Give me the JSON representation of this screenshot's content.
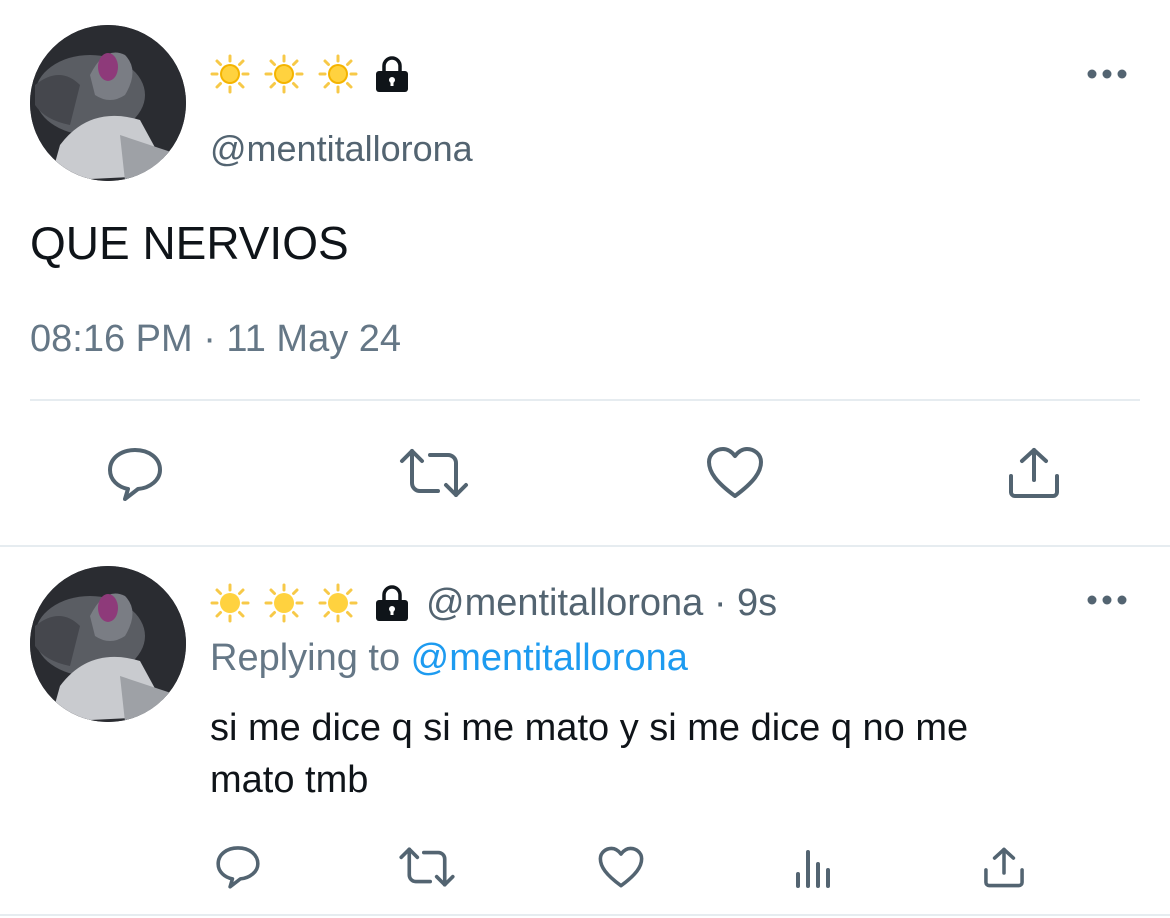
{
  "main_tweet": {
    "display_name_emojis": [
      "sun-emoji",
      "sun-emoji",
      "sun-emoji"
    ],
    "protected": true,
    "handle": "@mentitallorona",
    "text": "QUE NERVIOS",
    "timestamp": "08:16 PM · 11 May 24",
    "actions": [
      "reply-icon",
      "retweet-icon",
      "like-icon",
      "share-icon"
    ]
  },
  "reply_tweet": {
    "display_name_emojis": [
      "sun-emoji",
      "sun-emoji",
      "sun-emoji"
    ],
    "protected": true,
    "handle": "@mentitallorona",
    "separator": " · ",
    "age": "9s",
    "replying_label": "Replying to ",
    "replying_handle": "@mentitallorona",
    "text_line1": "si me dice q si me mato y si me dice q no me",
    "text_line2": "mato tmb",
    "actions": [
      "reply-icon",
      "retweet-icon",
      "like-icon",
      "analytics-icon",
      "share-icon"
    ]
  },
  "colors": {
    "text": "#0f1419",
    "secondary": "#657786",
    "link": "#1d9bf0",
    "icon": "#536471",
    "divider": "#e6ecf0"
  }
}
